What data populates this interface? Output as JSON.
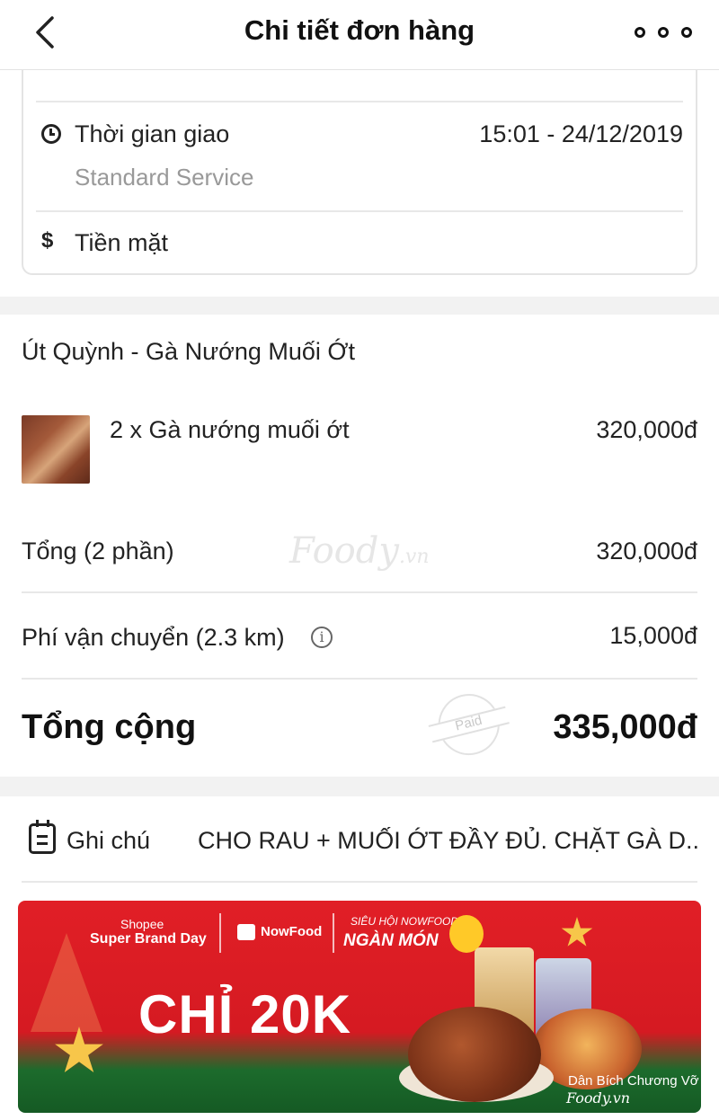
{
  "header": {
    "title": "Chi tiết đơn hàng"
  },
  "delivery": {
    "time_label": "Thời gian giao",
    "time_value": "15:01 - 24/12/2019",
    "service": "Standard Service",
    "payment": "Tiền mặt",
    "icons": {
      "time": "clock-icon",
      "payment": "dollar-icon"
    }
  },
  "order": {
    "restaurant": "Út Quỳnh - Gà Nướng Muối Ớt",
    "items": [
      {
        "line": "2 x Gà nướng muối ớt",
        "price": "320,000đ"
      }
    ]
  },
  "summary": {
    "subtotal_label": "Tổng (2 phần)",
    "subtotal_value": "320,000đ",
    "shipping_label": "Phí vận chuyển (2.3 km)",
    "shipping_value": "15,000đ",
    "total_label": "Tổng cộng",
    "total_value": "335,000đ",
    "paid_stamp": "Paid"
  },
  "watermark": {
    "brand": "Foody",
    "suffix": ".vn"
  },
  "note": {
    "label": "Ghi chú",
    "text": "CHO RAU + MUỐI ỚT ĐẦY ĐỦ. CHẶT GÀ D..."
  },
  "banner": {
    "shopee": "Shopee",
    "super_brand_day": "Super Brand Day",
    "nowfood": "NowFood",
    "sieu_hoi": "SIÊU HỘI NOWFOOD",
    "ngan_mon": "NGÀN MÓN",
    "headline": "CHỈ 20K",
    "credit": "Dân Bích Chương Vỡ",
    "foody": "Foody.vn"
  },
  "colors": {
    "banner_red": "#e11f26",
    "banner_green": "#1c6b2c",
    "star_gold": "#f7c64a",
    "muted_text": "#999999"
  }
}
